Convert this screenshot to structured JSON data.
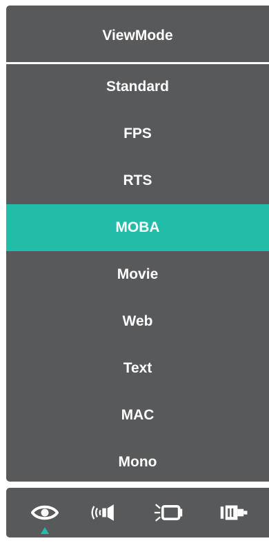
{
  "menu": {
    "title": "ViewMode",
    "items": [
      {
        "label": "Standard",
        "selected": false
      },
      {
        "label": "FPS",
        "selected": false
      },
      {
        "label": "RTS",
        "selected": false
      },
      {
        "label": "MOBA",
        "selected": true
      },
      {
        "label": "Movie",
        "selected": false
      },
      {
        "label": "Web",
        "selected": false
      },
      {
        "label": "Text",
        "selected": false
      },
      {
        "label": "MAC",
        "selected": false
      },
      {
        "label": "Mono",
        "selected": false
      }
    ],
    "selected_index": 3
  },
  "bottom_bar": {
    "icons": [
      {
        "name": "eye-icon",
        "active": true
      },
      {
        "name": "audio-speaker-icon",
        "active": false
      },
      {
        "name": "display-screen-icon",
        "active": false
      },
      {
        "name": "input-connector-icon",
        "active": false
      }
    ]
  },
  "colors": {
    "panel": "#58595b",
    "accent": "#22bca8",
    "text": "#ffffff"
  }
}
